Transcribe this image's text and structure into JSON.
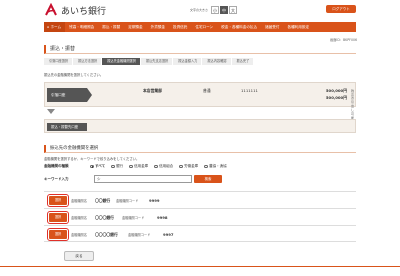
{
  "header": {
    "logo_text": "あいち銀行",
    "fontsize_label": "文字の大きさ",
    "fontsize_options": [
      "小",
      "中",
      "大"
    ],
    "logout_label": "ログアウト"
  },
  "nav": {
    "items": [
      "ホーム",
      "残高・明細照会",
      "振込・振替",
      "定期預金",
      "外貨預金",
      "投資信託",
      "住宅ローン",
      "税金・各種料金の払込",
      "諸届受付",
      "各種利用設定"
    ]
  },
  "screen_id": "画面ID：BKPF006",
  "page_title": "振込・振替",
  "steps": [
    "引落口座選択",
    "振込方法選択",
    "振込先金融機関選択",
    "振込先支店選択",
    "振込金額入力",
    "振込内容確認",
    "振込完了"
  ],
  "info_text": "振込先の金融機関を選択してください。",
  "from_account": {
    "label": "引落口座",
    "branch": "本店営業部",
    "type": "普通",
    "number": "1111111",
    "amount1": "500,000円",
    "amount1_label": "残高",
    "amount2": "500,000円",
    "amount2_label": "お引出し可能金額"
  },
  "to_account": {
    "label": "振込・振替先口座"
  },
  "section": {
    "title": "振込先の金融機関を選択",
    "desc": "金融機関を選択するか、キーワードで絞り込みをしてください。"
  },
  "filter": {
    "type_label": "金融機関の種類",
    "options": [
      "すべて",
      "銀行",
      "信用金庫",
      "信用組合",
      "労働金庫",
      "農協・漁協"
    ],
    "checked_index": 0,
    "keyword_label": "キーワード入力",
    "keyword_value": "シ",
    "search_label": "検索"
  },
  "results": [
    {
      "select_label": "選択",
      "name_label": "金融機関名",
      "name": "〇〇銀行",
      "code_label": "金融機関コード",
      "code": "9999"
    },
    {
      "select_label": "選択",
      "name_label": "金融機関名",
      "name": "〇〇〇銀行",
      "code_label": "金融機関コード",
      "code": "9998"
    },
    {
      "select_label": "選択",
      "name_label": "金融機関名",
      "name": "〇〇〇〇銀行",
      "code_label": "金融機関コード",
      "code": "9997"
    }
  ],
  "back_label": "戻る",
  "colors": {
    "accent": "#d9531a",
    "dark": "#555555"
  }
}
